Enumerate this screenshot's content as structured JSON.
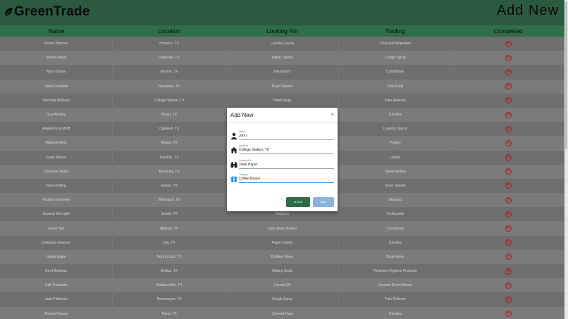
{
  "brand": {
    "name": "GreenTrade"
  },
  "header": {
    "add_new": "Add New"
  },
  "columns": [
    "Name",
    "Location",
    "Looking For",
    "Trading",
    "Completed"
  ],
  "rows": [
    [
      "Keven Harmon",
      "Houston, TX",
      "Laundry Sauce",
      "Charcoal Briquettes"
    ],
    [
      "Stefani Mapp",
      "Deanville, TX",
      "Paper Towels",
      "Cough Syrup"
    ],
    [
      "Myra Dimas",
      "Hearne, TX",
      "Deodorant",
      "Conditioner"
    ],
    [
      "Valda Cranford",
      "Navasota, TX",
      "Dryer Sheets",
      "Dish Pods"
    ],
    [
      "Hermina McIlvain",
      "College Station, TX",
      "Hand Soap",
      "Pain Reliever"
    ],
    [
      "Guy Akerley",
      "Bryan, TX",
      "",
      "Candles"
    ],
    [
      "Alejandro Eckhoff",
      "Caldwell, TX",
      "",
      "Laundry Sauce"
    ],
    [
      "Maxima Weis",
      "Milano, TX",
      "",
      "Pepper"
    ],
    [
      "Cayla Mercer",
      "Franklin, TX",
      "",
      "Lighter"
    ],
    [
      "Christene Hollar",
      "Benchley, TX",
      "",
      "Sweet Relish"
    ],
    [
      "Reine Billing",
      "Kurten, TX",
      "",
      "Dryer Sheets"
    ],
    [
      "Paulette Vanbeek",
      "Wheelock, TX",
      "",
      "Mustard"
    ],
    [
      "Cassidy Mccright",
      "Snook, TX",
      "Matches",
      "Toothpaste"
    ],
    [
      "Isreal Hall",
      "Millican, TX",
      "Jugs Water Bottles",
      "Conditioner"
    ],
    [
      "Celestina Alvarran",
      "Iola, TX",
      "Paper Towels",
      "Candles"
    ],
    [
      "Isabel Eagle",
      "North Zulch, TX",
      "Distilled Water",
      "Body Wash"
    ],
    [
      "Errol Brodnax",
      "Bedias, TX",
      "Baking Soda",
      "Feminine Hygiene Products"
    ],
    [
      "Judi Trousdale",
      "Madisonville, TX",
      "Canola Oil",
      "Canned Green Beans"
    ],
    [
      "Jada Fletchum",
      "Normangee, TX",
      "Cough Syrup",
      "Pain Reliever"
    ],
    [
      "Ahmad Harney",
      "Flynn, TX",
      "Canned Tuna",
      "Candles"
    ]
  ],
  "modal": {
    "title": "Add New",
    "close_x": "×",
    "name_label": "Name",
    "name_value": "John",
    "location_label": "Location",
    "location_value": "College Station, TX",
    "looking_label": "Looking For",
    "looking_value": "Toilet Paper",
    "trading_label": "Trading",
    "trading_value": "Coffee Beans",
    "close_btn": "CLOSE",
    "add_btn": "ADD"
  },
  "colors": {
    "header": "#2c5a3e",
    "accent": "#1e88e5",
    "delete": "#b01818"
  }
}
